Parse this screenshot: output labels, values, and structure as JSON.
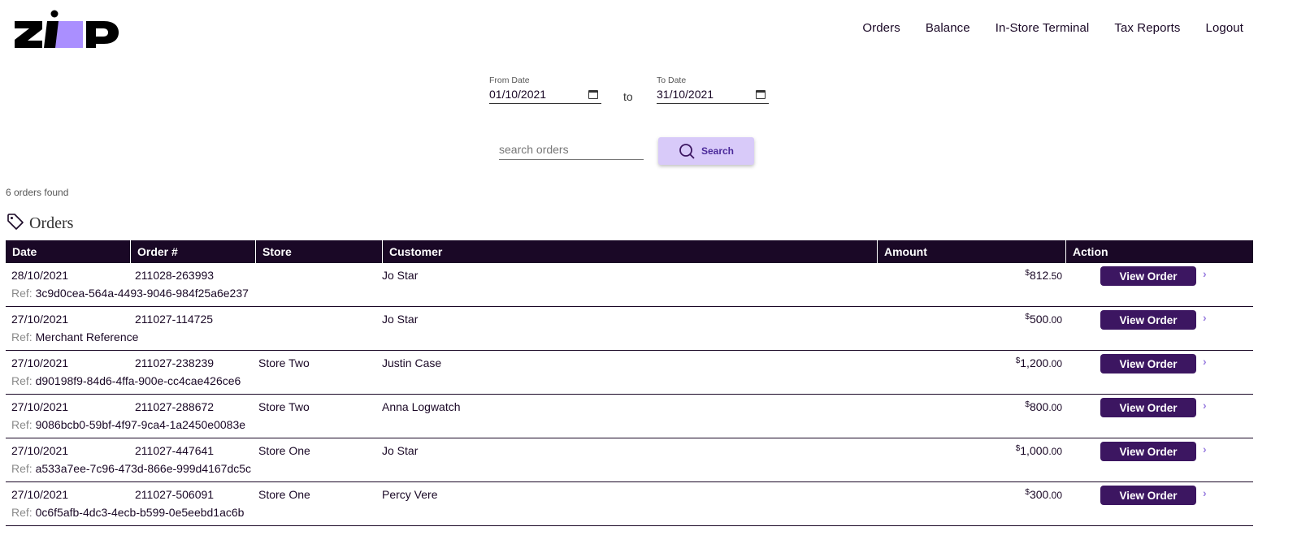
{
  "brand": {
    "logo": "zip",
    "accent": "#aa8fff",
    "dark": "#1a0826",
    "button": "#3c1661"
  },
  "nav": {
    "items": [
      {
        "label": "Orders"
      },
      {
        "label": "Balance"
      },
      {
        "label": "In-Store Terminal"
      },
      {
        "label": "Tax Reports"
      },
      {
        "label": "Logout"
      }
    ]
  },
  "filters": {
    "from_label": "From Date",
    "from_value": "01/10/2021",
    "to_word": "to",
    "to_label": "To Date",
    "to_value": "31/10/2021",
    "search_placeholder": "search orders",
    "search_button": "Search"
  },
  "results": {
    "count_text": "6 orders found",
    "section_title": "Orders"
  },
  "table": {
    "headers": {
      "date": "Date",
      "order": "Order #",
      "store": "Store",
      "customer": "Customer",
      "amount": "Amount",
      "action": "Action"
    },
    "ref_label": "Ref:",
    "action_label": "View Order",
    "rows": [
      {
        "date": "28/10/2021",
        "order": "211028-263993",
        "store": "",
        "customer": "Jo Star",
        "currency": "$",
        "amount_main": "812",
        "amount_cents": ".50",
        "ref": "3c9d0cea-564a-4493-9046-984f25a6e237"
      },
      {
        "date": "27/10/2021",
        "order": "211027-114725",
        "store": "",
        "customer": "Jo Star",
        "currency": "$",
        "amount_main": "500",
        "amount_cents": ".00",
        "ref": "Merchant Reference"
      },
      {
        "date": "27/10/2021",
        "order": "211027-238239",
        "store": "Store Two",
        "customer": "Justin Case",
        "currency": "$",
        "amount_main": "1,200",
        "amount_cents": ".00",
        "ref": "d90198f9-84d6-4ffa-900e-cc4cae426ce6"
      },
      {
        "date": "27/10/2021",
        "order": "211027-288672",
        "store": "Store Two",
        "customer": "Anna Logwatch",
        "currency": "$",
        "amount_main": "800",
        "amount_cents": ".00",
        "ref": "9086bcb0-59bf-4f97-9ca4-1a2450e0083e"
      },
      {
        "date": "27/10/2021",
        "order": "211027-447641",
        "store": "Store One",
        "customer": "Jo Star",
        "currency": "$",
        "amount_main": "1,000",
        "amount_cents": ".00",
        "ref": "a533a7ee-7c96-473d-866e-999d4167dc5c"
      },
      {
        "date": "27/10/2021",
        "order": "211027-506091",
        "store": "Store One",
        "customer": "Percy Vere",
        "currency": "$",
        "amount_main": "300",
        "amount_cents": ".00",
        "ref": "0c6f5afb-4dc3-4ecb-b599-0e5eebd1ac6b"
      }
    ]
  }
}
